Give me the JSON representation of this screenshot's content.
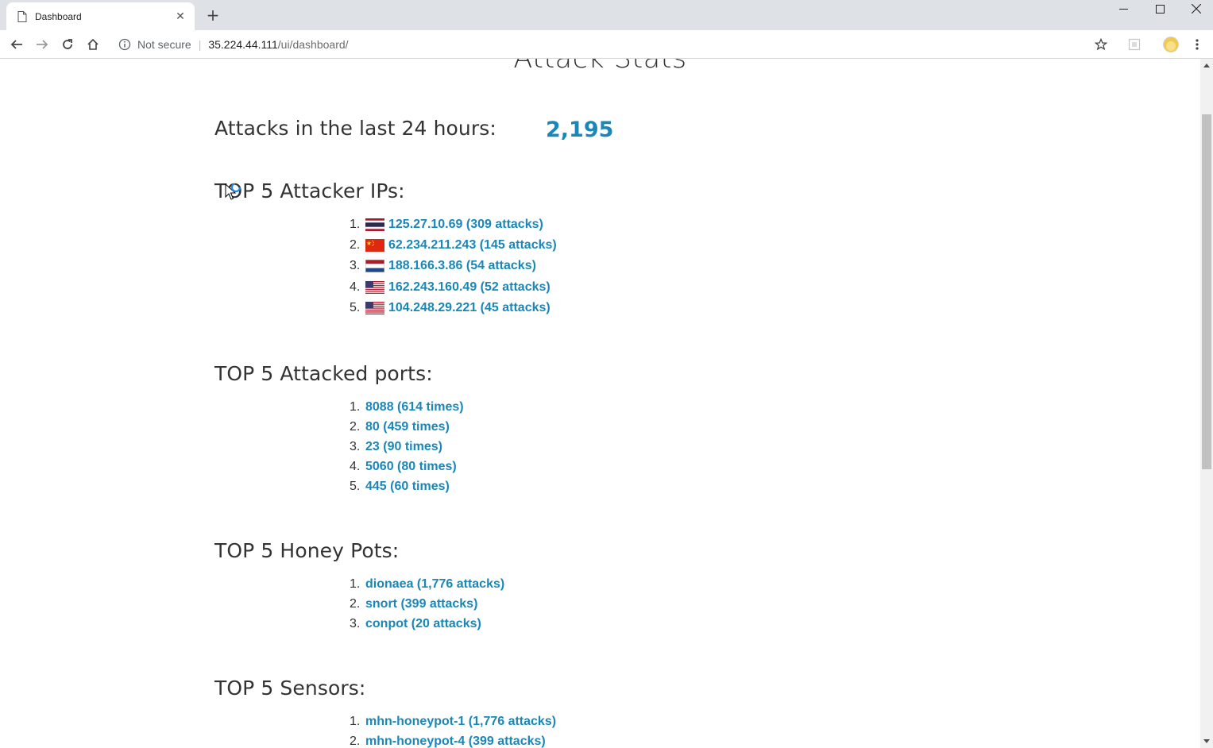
{
  "browser": {
    "tab_title": "Dashboard",
    "new_tab_label": "+",
    "security_label": "Not secure",
    "url_host": "35.224.44.111",
    "url_path": "/ui/dashboard/"
  },
  "page": {
    "title": "Attack Stats",
    "attacks_24h_label": "Attacks in the last 24 hours:",
    "attacks_24h_value": "2,195",
    "accent_color": "#1a87b9",
    "top_ips": {
      "heading": "TOP 5 Attacker IPs:",
      "items": [
        {
          "num": "1.",
          "flag": "thailand-flag",
          "text": "125.27.10.69 (309 attacks)"
        },
        {
          "num": "2.",
          "flag": "china-flag",
          "text": "62.234.211.243 (145 attacks)"
        },
        {
          "num": "3.",
          "flag": "netherlands-flag",
          "text": "188.166.3.86 (54 attacks)"
        },
        {
          "num": "4.",
          "flag": "usa-flag",
          "text": "162.243.160.49 (52 attacks)"
        },
        {
          "num": "5.",
          "flag": "usa-flag",
          "text": "104.248.29.221 (45 attacks)"
        }
      ]
    },
    "top_ports": {
      "heading": "TOP 5 Attacked ports:",
      "items": [
        {
          "num": "1.",
          "text": "8088 (614 times)"
        },
        {
          "num": "2.",
          "text": "80 (459 times)"
        },
        {
          "num": "3.",
          "text": "23 (90 times)"
        },
        {
          "num": "4.",
          "text": "5060 (80 times)"
        },
        {
          "num": "5.",
          "text": "445 (60 times)"
        }
      ]
    },
    "top_honeypots": {
      "heading": "TOP 5 Honey Pots:",
      "items": [
        {
          "num": "1.",
          "text": "dionaea (1,776 attacks)"
        },
        {
          "num": "2.",
          "text": "snort (399 attacks)"
        },
        {
          "num": "3.",
          "text": "conpot (20 attacks)"
        }
      ]
    },
    "top_sensors": {
      "heading": "TOP 5 Sensors:",
      "items": [
        {
          "num": "1.",
          "text": "mhn-honeypot-1 (1,776 attacks)"
        },
        {
          "num": "2.",
          "text": "mhn-honeypot-4 (399 attacks)"
        }
      ]
    }
  }
}
